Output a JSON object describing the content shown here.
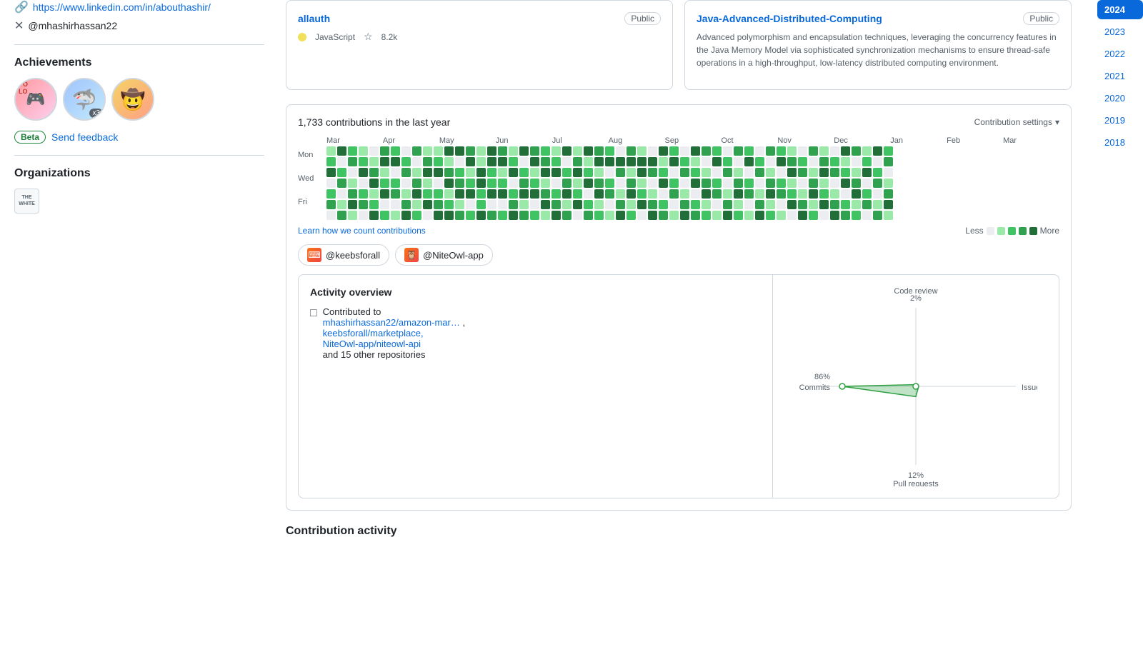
{
  "sidebar": {
    "linkedin_url": "https://www.linkedin.com/in/abouthashir/",
    "twitter_handle": "@mhashirhassan22",
    "achievements_title": "Achievements",
    "badges": [
      {
        "emoji": "🎮",
        "bg": "pink",
        "label": "YOLO badge"
      },
      {
        "emoji": "🦈",
        "bg": "blue",
        "label": "Shark badge",
        "count": "x3"
      },
      {
        "emoji": "🤠",
        "bg": "gold",
        "label": "Cowboy badge"
      }
    ],
    "beta_label": "Beta",
    "send_feedback_label": "Send feedback",
    "organizations_title": "Organizations",
    "org_name": "The White org"
  },
  "repos": [
    {
      "name": "allauth",
      "visibility": "Public",
      "description": "",
      "language": "JavaScript",
      "lang_color": "#f1e05a",
      "stars": "8.2k"
    },
    {
      "name": "Java-Advanced-Distributed-Computing",
      "visibility": "Public",
      "description": "Advanced polymorphism and encapsulation techniques, leveraging the concurrency features in the Java Memory Model via sophisticated synchronization mechanisms to ensure thread-safe operations in a high-throughput, low-latency distributed computing environment.",
      "language": "",
      "stars": ""
    }
  ],
  "contributions": {
    "title": "1,733 contributions in the last year",
    "settings_label": "Contribution settings",
    "months": [
      "Mar",
      "Apr",
      "May",
      "Jun",
      "Jul",
      "Aug",
      "Sep",
      "Oct",
      "Nov",
      "Dec",
      "Jan",
      "Feb",
      "Mar"
    ],
    "day_labels": [
      "Mon",
      "",
      "Wed",
      "",
      "Fri",
      ""
    ],
    "learn_link": "Learn how we count contributions",
    "less_label": "Less",
    "more_label": "More"
  },
  "org_tabs": [
    {
      "handle": "@keebsforall",
      "color": "#e85d04"
    },
    {
      "handle": "@NiteOwl-app",
      "color": "#e85d04"
    }
  ],
  "activity": {
    "title": "Activity overview",
    "contributed_label": "Contributed to",
    "repos": [
      "mhashirhassan22/amazon-mar…",
      "keebsforall/marketplace,",
      "NiteOwl-app/niteowl-api"
    ],
    "other_repos": "and 15 other repositories",
    "radar": {
      "commits_pct": "86%",
      "commits_label": "Commits",
      "code_review_pct": "2%",
      "code_review_label": "Code review",
      "issues_pct": "",
      "issues_label": "Issues",
      "pull_requests_pct": "12%",
      "pull_requests_label": "Pull requests"
    }
  },
  "year_nav": {
    "years": [
      "2024",
      "2023",
      "2022",
      "2021",
      "2020",
      "2019",
      "2018"
    ],
    "active": "2024"
  },
  "contribution_activity_heading": "Contribution activity"
}
